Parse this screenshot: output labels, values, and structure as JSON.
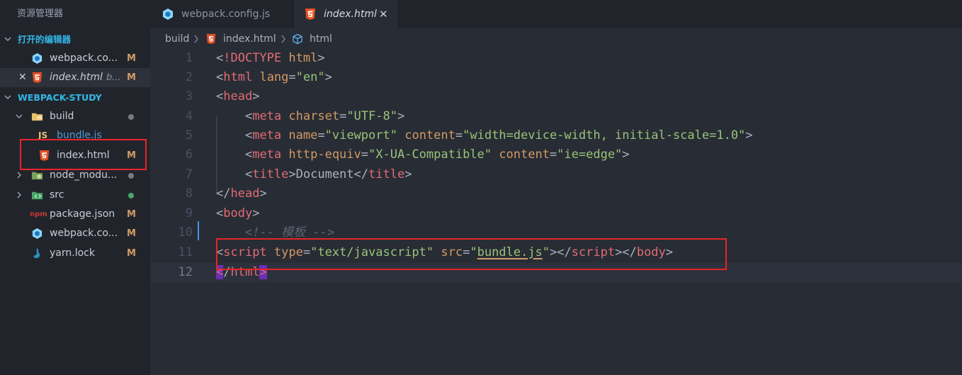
{
  "explorer_title": "资源管理器",
  "tabs": [
    {
      "label": "webpack.config.js",
      "icon": "webpack-icon"
    },
    {
      "label": "index.html",
      "icon": "html5-icon",
      "close": "✕"
    }
  ],
  "sidebar": {
    "open_editors_header": "打开的编辑器",
    "open_editors": [
      {
        "name": "webpack.co...",
        "badge": "M",
        "icon": "webpack-icon"
      },
      {
        "name": "index.html",
        "suffix": "b...",
        "badge": "M",
        "icon": "html5-icon",
        "close": "✕"
      }
    ],
    "project_header": "WEBPACK-STUDY",
    "tree": [
      {
        "name": "build",
        "type": "folder",
        "icon": "build-folder-icon"
      },
      {
        "name": "bundle.js",
        "type": "file",
        "icon": "js-icon",
        "icon_text": "JS"
      },
      {
        "name": "index.html",
        "type": "file",
        "badge": "M",
        "icon": "html5-icon"
      },
      {
        "name": "node_modu...",
        "type": "folder",
        "icon": "node-folder-icon"
      },
      {
        "name": "src",
        "type": "folder",
        "icon": "src-folder-icon"
      },
      {
        "name": "package.json",
        "type": "file",
        "badge": "M",
        "icon": "npm-icon",
        "icon_text": "npm"
      },
      {
        "name": "webpack.co...",
        "type": "file",
        "badge": "M",
        "icon": "webpack-icon"
      },
      {
        "name": "yarn.lock",
        "type": "file",
        "badge": "M",
        "icon": "yarn-icon"
      }
    ]
  },
  "breadcrumb": [
    "build",
    "index.html",
    "html"
  ],
  "editor": {
    "line_numbers": [
      "1",
      "2",
      "3",
      "4",
      "5",
      "6",
      "7",
      "8",
      "9",
      "10",
      "11",
      "12"
    ]
  },
  "colors": {
    "accent": "#33b7e8",
    "modified": "#d19a66",
    "highlight_box": "#e8242a"
  }
}
